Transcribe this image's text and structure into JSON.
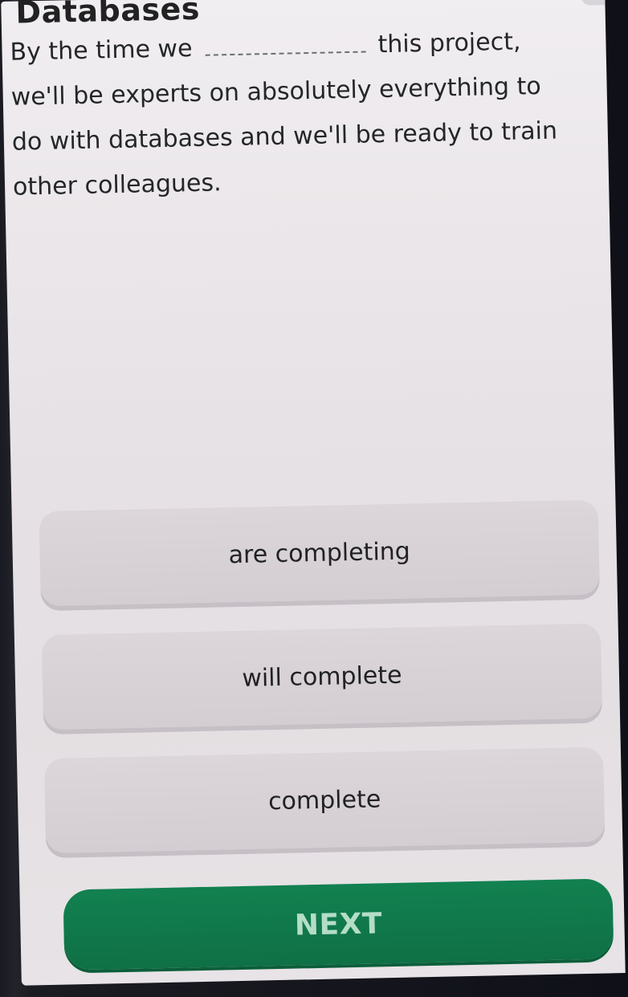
{
  "header": {
    "title": "Databases"
  },
  "question": {
    "before": "By the time we",
    "after": "this project, we'll be experts on absolutely everything to do with databases and we'll be ready to train other colleagues."
  },
  "options": [
    {
      "label": "are completing"
    },
    {
      "label": "will complete"
    },
    {
      "label": "complete"
    }
  ],
  "actions": {
    "next_label": "NEXT"
  },
  "colors": {
    "primary": "#0f7046",
    "option_bg": "#d4cdd1",
    "screen_bg": "#ebe7ea"
  }
}
